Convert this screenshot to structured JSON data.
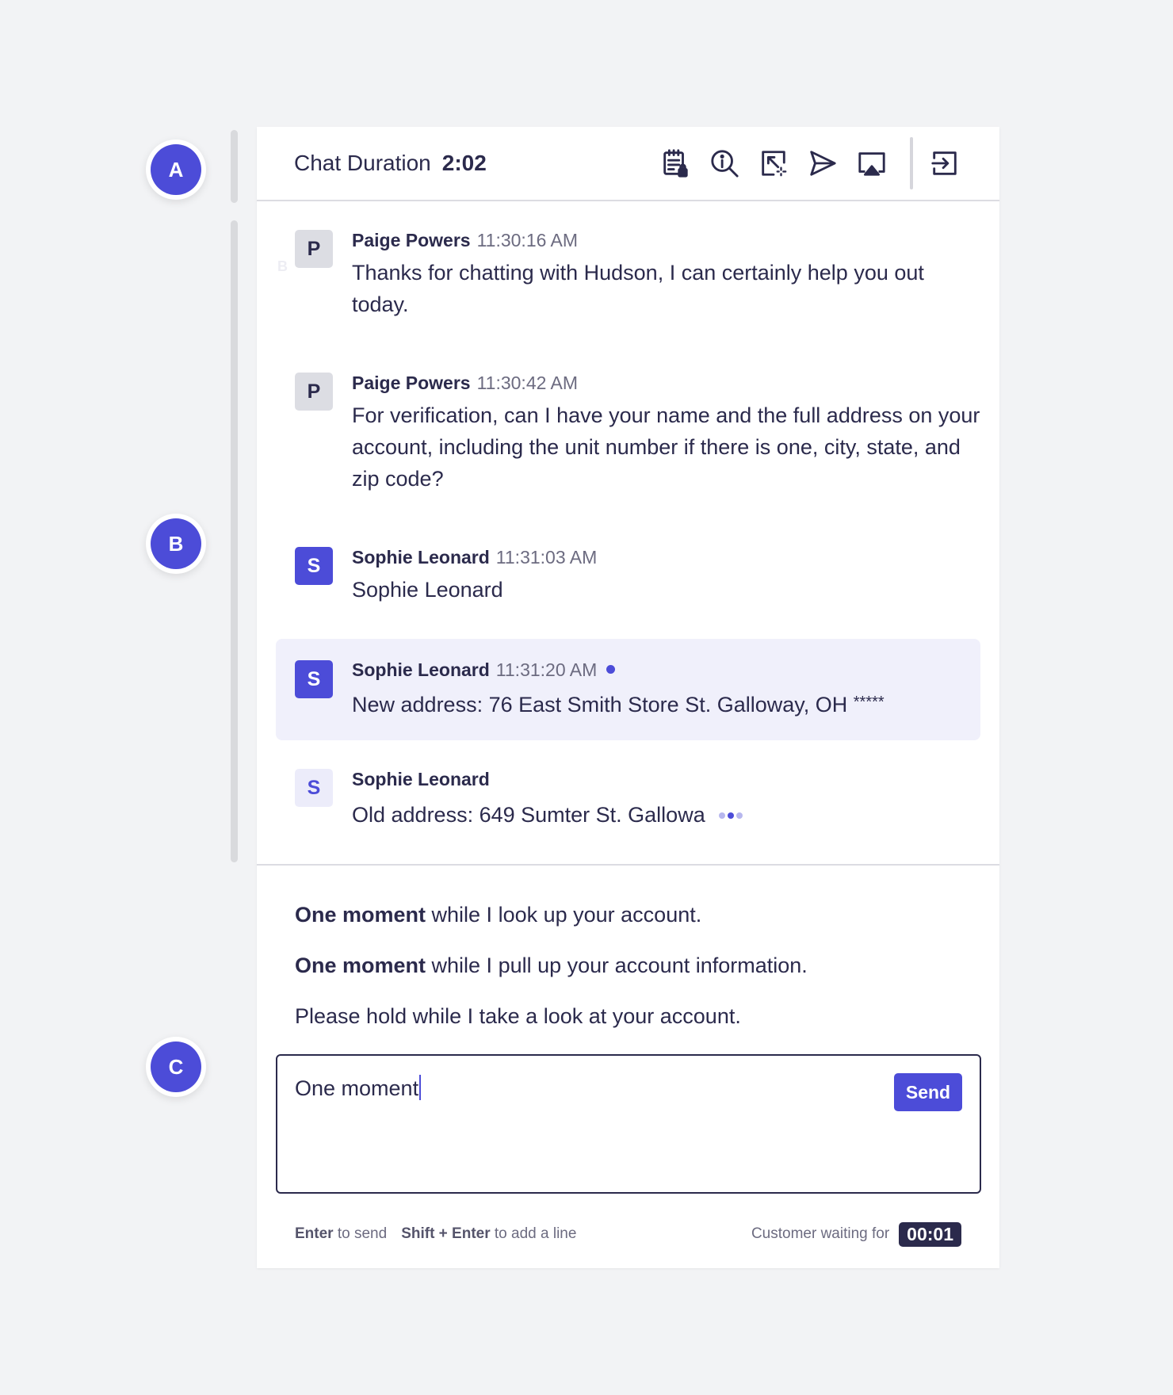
{
  "markers": {
    "a": "A",
    "b": "B",
    "c": "C"
  },
  "header": {
    "duration_label": "Chat Duration",
    "duration_value": "2:02",
    "tools": [
      "notes-lock-icon",
      "search-info-icon",
      "screen-capture-icon",
      "send-icon",
      "airplay-icon",
      "exit-icon"
    ]
  },
  "messages": [
    {
      "avatar": "P",
      "name": "Paige Powers",
      "time": "11:30:16 AM",
      "text": "Thanks for chatting with Hudson, I can certainly help you out today."
    },
    {
      "avatar": "P",
      "name": "Paige Powers",
      "time": "11:30:42 AM",
      "text": "For verification, can I have your name and the full address on your account, including the unit number if there is one, city, state, and zip code?"
    },
    {
      "avatar": "S",
      "name": "Sophie Leonard",
      "time": "11:31:03 AM",
      "text": "Sophie Leonard"
    },
    {
      "avatar": "S",
      "name": "Sophie Leonard",
      "time": "11:31:20 AM",
      "text": "New address: 76 East Smith Store St. Galloway, OH",
      "masked": "*****",
      "unread": true
    },
    {
      "avatar": "S",
      "name": "Sophie Leonard",
      "time": "",
      "text": "Old address: 649 Sumter St.  Gallowa",
      "typing": true
    }
  ],
  "ghost_label": "B",
  "suggestions": [
    {
      "bold": "One moment",
      "rest": " while I look up your account."
    },
    {
      "bold": "One moment",
      "rest": " while I pull up your account information."
    },
    {
      "bold": "",
      "rest": "Please hold while I take a look at your account."
    }
  ],
  "composer": {
    "value": "One moment",
    "send_label": "Send"
  },
  "footer": {
    "enter_key": "Enter",
    "enter_action": " to send",
    "shift_key": "Shift + Enter",
    "shift_action": " to add a line",
    "waiting_label": "Customer waiting for",
    "waiting_timer": "00:01"
  },
  "colors": {
    "accent": "#4c4cd8",
    "text": "#2b2a4c",
    "highlight": "#f0f0fb",
    "muted": "#6c6b80"
  }
}
